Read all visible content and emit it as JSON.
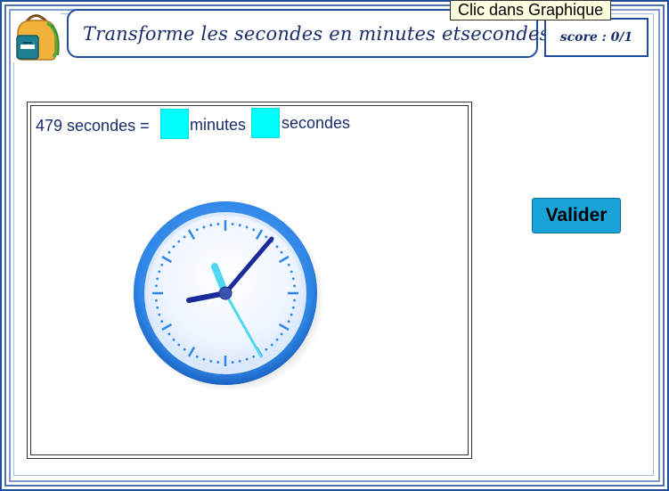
{
  "header": {
    "title": "Transforme les secondes en minutes etsecondes",
    "score": "score : 0/1"
  },
  "tooltip": {
    "text": "Clic dans Graphique"
  },
  "question": {
    "prefix": "479 secondes =",
    "minutes_label": "minutes",
    "seconds_label": "secondes",
    "minutes_value": "",
    "seconds_value": ""
  },
  "buttons": {
    "validate_label": "Valider"
  },
  "icons": {
    "logo": "backpack-icon",
    "clock": "clock-icon"
  },
  "colors": {
    "frame": "#1e4f9c",
    "text": "#1a2d6b",
    "answer_fill": "#00ffff",
    "button": "#1aa3d9",
    "clock_ring": "#2f86e6",
    "hour_hand": "#1c2a99",
    "second_hand": "#4fd8f0"
  }
}
